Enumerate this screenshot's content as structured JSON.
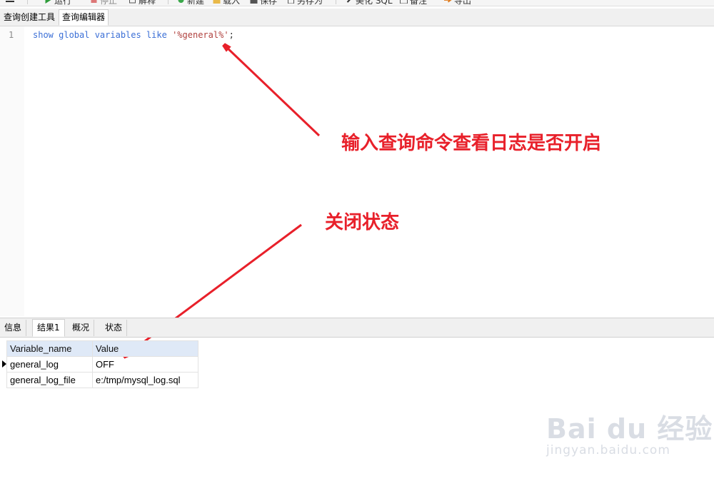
{
  "toolbar": {
    "items": [
      {
        "label": "运行",
        "icon": "run-icon"
      },
      {
        "label": "停止",
        "icon": "stop-icon"
      },
      {
        "label": "解释",
        "icon": "explain-icon"
      },
      {
        "label": "新建",
        "icon": "new-icon"
      },
      {
        "label": "载入",
        "icon": "load-icon"
      },
      {
        "label": "保存",
        "icon": "save-icon"
      },
      {
        "label": "另存为",
        "icon": "save-as-icon"
      },
      {
        "label": "美化 SQL",
        "icon": "beautify-sql-icon"
      },
      {
        "label": "备注",
        "icon": "comment-icon"
      },
      {
        "label": "导出",
        "icon": "export-icon"
      }
    ]
  },
  "tabs": [
    "查询创建工具",
    "查询编辑器"
  ],
  "editor": {
    "line_number": "1",
    "code": {
      "keywords": "show global variables like ",
      "string": "'%general%'",
      "terminator": ";"
    }
  },
  "annotations": {
    "query_note": "输入查询命令查看日志是否开启",
    "status_note": "关闭状态"
  },
  "result_tabs": [
    "信息",
    "结果1",
    "概况",
    "状态"
  ],
  "result_table": {
    "columns": [
      "Variable_name",
      "Value"
    ],
    "rows": [
      [
        "general_log",
        "OFF"
      ],
      [
        "general_log_file",
        "e:/tmp/mysql_log.sql"
      ]
    ]
  },
  "watermark": {
    "brand": "Bai du 经验",
    "url": "jingyan.baidu.com"
  },
  "colors": {
    "annotation": "#e8202a",
    "keyword": "#3b6fd6",
    "string": "#b0413e",
    "header_bg": "#dfe9f7"
  }
}
